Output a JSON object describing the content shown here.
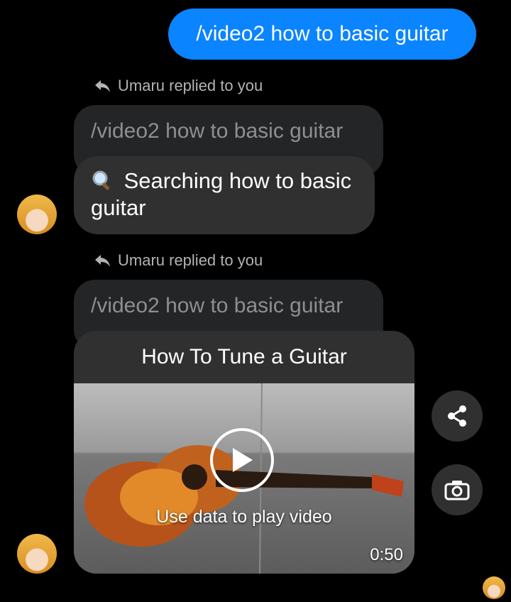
{
  "outgoing": {
    "text": "/video2 how to basic guitar"
  },
  "replies": [
    {
      "reply_label": "Umaru replied to you",
      "quoted": "/video2 how to basic guitar",
      "message_icon": "magnifier-emoji",
      "message": "Searching how to basic guitar"
    },
    {
      "reply_label": "Umaru replied to you",
      "quoted": "/video2 how to basic guitar",
      "video": {
        "title": "How To Tune a Guitar",
        "caption": "Use data to play video",
        "duration": "0:50"
      }
    }
  ],
  "actions": {
    "share_icon": "share-icon",
    "camera_icon": "camera-icon"
  },
  "colors": {
    "accent": "#0a84ff",
    "bubble": "#303030",
    "quoted": "#242526"
  }
}
